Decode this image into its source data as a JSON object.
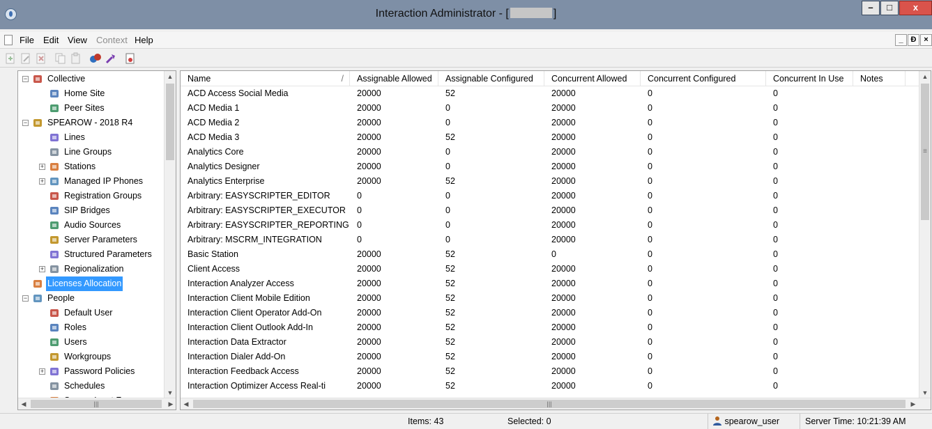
{
  "window": {
    "title_prefix": "Interaction Administrator - [",
    "title_suffix": "]",
    "controls": {
      "minimize": "–",
      "maximize": "□",
      "close": "x"
    }
  },
  "menu": {
    "items": [
      {
        "label": "File",
        "enabled": true
      },
      {
        "label": "Edit",
        "enabled": true
      },
      {
        "label": "View",
        "enabled": true
      },
      {
        "label": "Context",
        "enabled": false
      },
      {
        "label": "Help",
        "enabled": true
      }
    ],
    "mdi": {
      "minimize": "_",
      "restore": "Ɖ",
      "close": "×"
    }
  },
  "toolbar": {
    "buttons": [
      {
        "name": "add-icon",
        "enabled": false
      },
      {
        "name": "edit-icon",
        "enabled": false
      },
      {
        "name": "delete-icon",
        "enabled": false
      },
      {
        "name": "copy-icon",
        "enabled": false
      },
      {
        "name": "paste-icon",
        "enabled": false
      },
      {
        "name": "connect-icon",
        "enabled": true
      },
      {
        "name": "tools-icon",
        "enabled": true
      },
      {
        "name": "license-icon",
        "enabled": true
      }
    ]
  },
  "tree": {
    "items": [
      {
        "label": "Collective",
        "icon": "collective-icon",
        "level": 0,
        "expander": "−"
      },
      {
        "label": "Home Site",
        "icon": "home-site-icon",
        "level": 1,
        "expander": ""
      },
      {
        "label": "Peer Sites",
        "icon": "peer-sites-icon",
        "level": 1,
        "expander": ""
      },
      {
        "label": "SPEAROW - 2018 R4",
        "icon": "server-icon",
        "level": 0,
        "expander": "−"
      },
      {
        "label": "Lines",
        "icon": "lines-icon",
        "level": 1,
        "expander": ""
      },
      {
        "label": "Line Groups",
        "icon": "line-groups-icon",
        "level": 1,
        "expander": ""
      },
      {
        "label": "Stations",
        "icon": "stations-icon",
        "level": 1,
        "expander": "+"
      },
      {
        "label": "Managed IP Phones",
        "icon": "phone-icon",
        "level": 1,
        "expander": "+"
      },
      {
        "label": "Registration Groups",
        "icon": "registration-icon",
        "level": 1,
        "expander": ""
      },
      {
        "label": "SIP Bridges",
        "icon": "sip-bridge-icon",
        "level": 1,
        "expander": ""
      },
      {
        "label": "Audio Sources",
        "icon": "audio-icon",
        "level": 1,
        "expander": ""
      },
      {
        "label": "Server Parameters",
        "icon": "server-params-icon",
        "level": 1,
        "expander": ""
      },
      {
        "label": "Structured Parameters",
        "icon": "structured-params-icon",
        "level": 1,
        "expander": ""
      },
      {
        "label": "Regionalization",
        "icon": "globe-icon",
        "level": 1,
        "expander": "+"
      },
      {
        "label": "Licenses Allocation",
        "icon": "license-icon",
        "level": 0,
        "expander": "",
        "selected": true
      },
      {
        "label": "People",
        "icon": "people-icon",
        "level": 0,
        "expander": "−"
      },
      {
        "label": "Default User",
        "icon": "default-user-icon",
        "level": 1,
        "expander": ""
      },
      {
        "label": "Roles",
        "icon": "roles-icon",
        "level": 1,
        "expander": ""
      },
      {
        "label": "Users",
        "icon": "user-icon",
        "level": 1,
        "expander": ""
      },
      {
        "label": "Workgroups",
        "icon": "workgroups-icon",
        "level": 1,
        "expander": ""
      },
      {
        "label": "Password Policies",
        "icon": "key-icon",
        "level": 1,
        "expander": "+"
      },
      {
        "label": "Schedules",
        "icon": "calendar-icon",
        "level": 1,
        "expander": ""
      },
      {
        "label": "Secure Input Forms",
        "icon": "form-icon",
        "level": 1,
        "expander": ""
      }
    ]
  },
  "grid": {
    "columns": [
      "Name",
      "Assignable Allowed",
      "Assignable Configured",
      "Concurrent Allowed",
      "Concurrent Configured",
      "Concurrent In Use",
      "Notes"
    ],
    "sort_indicator": "/",
    "rows": [
      [
        "ACD Access Social Media",
        "20000",
        "52",
        "20000",
        "0",
        "0",
        ""
      ],
      [
        "ACD Media 1",
        "20000",
        "0",
        "20000",
        "0",
        "0",
        ""
      ],
      [
        "ACD Media 2",
        "20000",
        "0",
        "20000",
        "0",
        "0",
        ""
      ],
      [
        "ACD Media 3",
        "20000",
        "52",
        "20000",
        "0",
        "0",
        ""
      ],
      [
        "Analytics Core",
        "20000",
        "0",
        "20000",
        "0",
        "0",
        ""
      ],
      [
        "Analytics Designer",
        "20000",
        "0",
        "20000",
        "0",
        "0",
        ""
      ],
      [
        "Analytics Enterprise",
        "20000",
        "52",
        "20000",
        "0",
        "0",
        ""
      ],
      [
        "Arbitrary: EASYSCRIPTER_EDITOR",
        "0",
        "0",
        "20000",
        "0",
        "0",
        ""
      ],
      [
        "Arbitrary: EASYSCRIPTER_EXECUTOR",
        "0",
        "0",
        "20000",
        "0",
        "0",
        ""
      ],
      [
        "Arbitrary: EASYSCRIPTER_REPORTING",
        "0",
        "0",
        "20000",
        "0",
        "0",
        ""
      ],
      [
        "Arbitrary: MSCRM_INTEGRATION",
        "0",
        "0",
        "20000",
        "0",
        "0",
        ""
      ],
      [
        "Basic Station",
        "20000",
        "52",
        "0",
        "0",
        "0",
        ""
      ],
      [
        "Client Access",
        "20000",
        "52",
        "20000",
        "0",
        "0",
        ""
      ],
      [
        "Interaction Analyzer Access",
        "20000",
        "52",
        "20000",
        "0",
        "0",
        ""
      ],
      [
        "Interaction Client Mobile Edition",
        "20000",
        "52",
        "20000",
        "0",
        "0",
        ""
      ],
      [
        "Interaction Client Operator Add-On",
        "20000",
        "52",
        "20000",
        "0",
        "0",
        ""
      ],
      [
        "Interaction Client Outlook Add-In",
        "20000",
        "52",
        "20000",
        "0",
        "0",
        ""
      ],
      [
        "Interaction Data Extractor",
        "20000",
        "52",
        "20000",
        "0",
        "0",
        ""
      ],
      [
        "Interaction Dialer Add-On",
        "20000",
        "52",
        "20000",
        "0",
        "0",
        ""
      ],
      [
        "Interaction Feedback Access",
        "20000",
        "52",
        "20000",
        "0",
        "0",
        ""
      ],
      [
        "Interaction Optimizer Access Real-ti",
        "20000",
        "52",
        "20000",
        "0",
        "0",
        ""
      ]
    ]
  },
  "statusbar": {
    "items": "Items: 43",
    "selected": "Selected: 0",
    "user": "spearow_user",
    "server_time": "Server Time: 10:21:39 AM"
  },
  "colors": {
    "titlebar": "#7e8fa6",
    "selection": "#3399ff",
    "close_button": "#d9534b"
  }
}
